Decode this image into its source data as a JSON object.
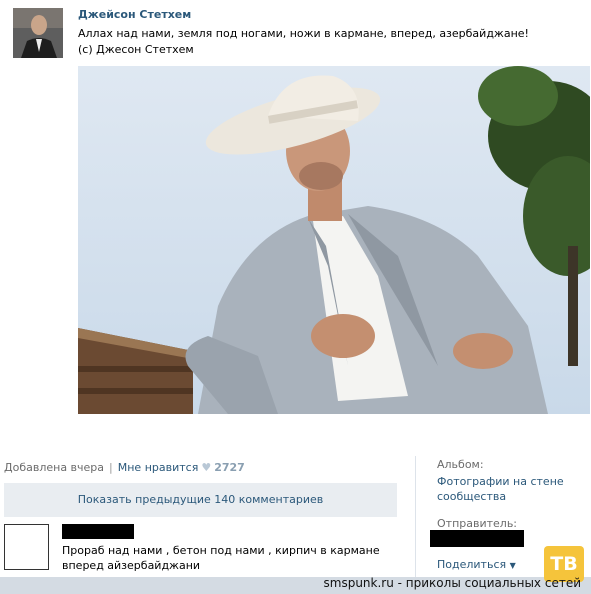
{
  "post": {
    "author": "Джейсон Стетхем",
    "text_lines": [
      "Аллах над нами, земля под ногами, ножи в кармане, вперед, азербайджане!",
      "(с) Джесон Стетхем"
    ]
  },
  "actions": {
    "added": "Добавлена вчера",
    "like_label": "Мне нравится",
    "likes_count": "2727"
  },
  "comments": {
    "show_previous": "Показать предыдущие 140 комментариев",
    "items": [
      {
        "text": "Прораб над нами , бетон под нами , кирпич в кармане вперед айзербайджани"
      }
    ]
  },
  "sidebar": {
    "album_label": "Альбом:",
    "album_value": "Фотографии на стене сообщества",
    "sender_label": "Отправитель:",
    "share_label": "Поделиться"
  },
  "watermark": {
    "logo": "ТВ",
    "text": "smspunk.ru - приколы социальных сетей"
  },
  "colors": {
    "link": "#2b587a",
    "muted": "#6b6b6b",
    "button_bg": "#e9edf1"
  },
  "icons": [
    "heart-icon",
    "chevron-down-icon"
  ]
}
